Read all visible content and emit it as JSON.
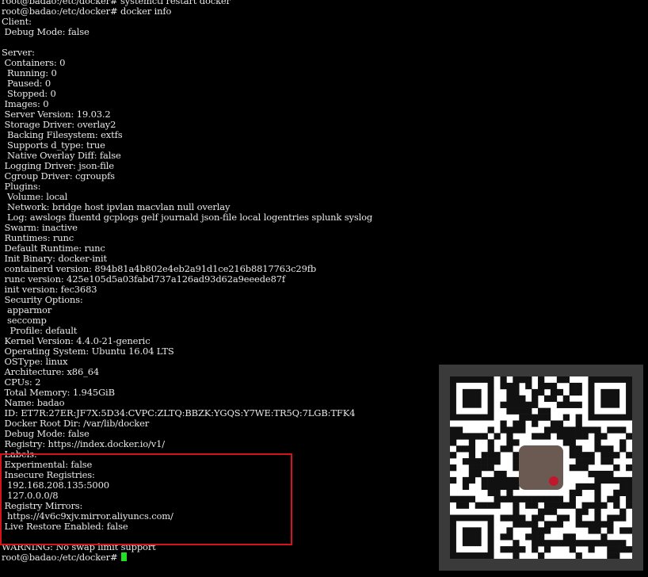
{
  "terminal": {
    "lines": [
      "root@badao:/etc/docker# systemctl restart docker",
      "root@badao:/etc/docker# docker info",
      "Client:",
      " Debug Mode: false",
      "",
      "Server:",
      " Containers: 0",
      "  Running: 0",
      "  Paused: 0",
      "  Stopped: 0",
      " Images: 0",
      " Server Version: 19.03.2",
      " Storage Driver: overlay2",
      "  Backing Filesystem: extfs",
      "  Supports d_type: true",
      "  Native Overlay Diff: false",
      " Logging Driver: json-file",
      " Cgroup Driver: cgroupfs",
      " Plugins:",
      "  Volume: local",
      "  Network: bridge host ipvlan macvlan null overlay",
      "  Log: awslogs fluentd gcplogs gelf journald json-file local logentries splunk syslog",
      " Swarm: inactive",
      " Runtimes: runc",
      " Default Runtime: runc",
      " Init Binary: docker-init",
      " containerd version: 894b81a4b802e4eb2a91d1ce216b8817763c29fb",
      " runc version: 425e105d5a03fabd737a126ad93d62a9eeede87f",
      " init version: fec3683",
      " Security Options:",
      "  apparmor",
      "  seccomp",
      "   Profile: default",
      " Kernel Version: 4.4.0-21-generic",
      " Operating System: Ubuntu 16.04 LTS",
      " OSType: linux",
      " Architecture: x86_64",
      " CPUs: 2",
      " Total Memory: 1.945GiB",
      " Name: badao",
      " ID: ET7R:27ER:JF7X:5D34:CVPC:ZLTQ:BBZK:YGQS:Y7WE:TR5Q:7LGB:TFK4",
      " Docker Root Dir: /var/lib/docker",
      " Debug Mode: false",
      " Registry: https://index.docker.io/v1/",
      " Labels:",
      " Experimental: false",
      " Insecure Registries:",
      "  192.168.208.135:5000",
      "  127.0.0.0/8",
      " Registry Mirrors:",
      "  https://4v6c9xjv.mirror.aliyuncs.com/",
      " Live Restore Enabled: false",
      "",
      "WARNING: No swap limit support"
    ],
    "prompt": "root@badao:/etc/docker# "
  },
  "colors": {
    "background": "#000000",
    "foreground": "#e8e8e8",
    "cursor": "#22e022",
    "highlight_border": "#d4141c",
    "qr_panel": "#3a3a3a"
  },
  "overlay": {
    "highlight_box": "red rectangle around Labels through Live Restore Enabled",
    "qr_code": "qr-code-image"
  }
}
